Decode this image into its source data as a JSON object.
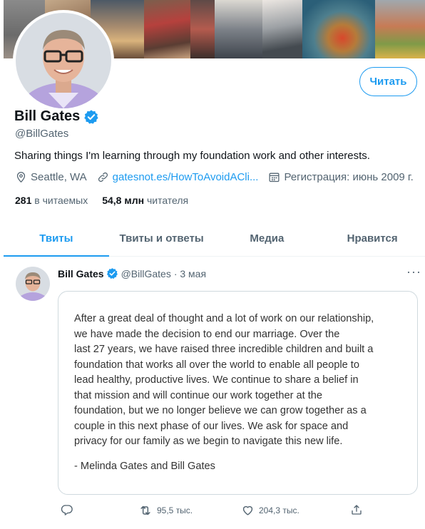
{
  "profile": {
    "name": "Bill Gates",
    "handle": "@BillGates",
    "bio": "Sharing things I'm learning through my foundation work and other interests.",
    "location": "Seattle, WA",
    "website": "gatesnot.es/HowToAvoidACli...",
    "joined": "Регистрация: июнь 2009 г.",
    "following_count": "281",
    "following_label": "в читаемых",
    "followers_count": "54,8 млн",
    "followers_label": "читателя",
    "follow_button": "Читать"
  },
  "tabs": [
    {
      "label": "Твиты",
      "active": true
    },
    {
      "label": "Твиты и ответы",
      "active": false
    },
    {
      "label": "Медиа",
      "active": false
    },
    {
      "label": "Нравится",
      "active": false
    }
  ],
  "tweet": {
    "author": "Bill Gates",
    "handle": "@BillGates",
    "time": "· 3 мая",
    "more": "···",
    "statement_lines": [
      "After a great deal of thought and a lot of work on our relationship,",
      "we have made the decision to end our marriage. Over the",
      "last 27 years, we have raised three incredible children and built a",
      "foundation that works all over the world to enable all people to",
      "lead healthy, productive lives. We continue to share a belief in",
      "that mission and will continue our work together at the",
      "foundation, but we no longer believe we can grow together as a",
      "couple in this next phase of our lives. We ask for space and",
      "privacy for our family as we begin to navigate this new life."
    ],
    "signature": "- Melinda Gates and Bill Gates",
    "retweets": "95,5 тыс.",
    "likes": "204,3 тыс."
  },
  "icons": {
    "verified": "verified-badge-icon",
    "location": "location-pin-icon",
    "link": "link-icon",
    "calendar": "calendar-icon",
    "reply": "reply-icon",
    "retweet": "retweet-icon",
    "like": "heart-icon",
    "share": "share-icon"
  },
  "colors": {
    "accent": "#1d9bf0",
    "text": "#0f1419",
    "muted": "#536471",
    "border": "#cfd9de"
  }
}
